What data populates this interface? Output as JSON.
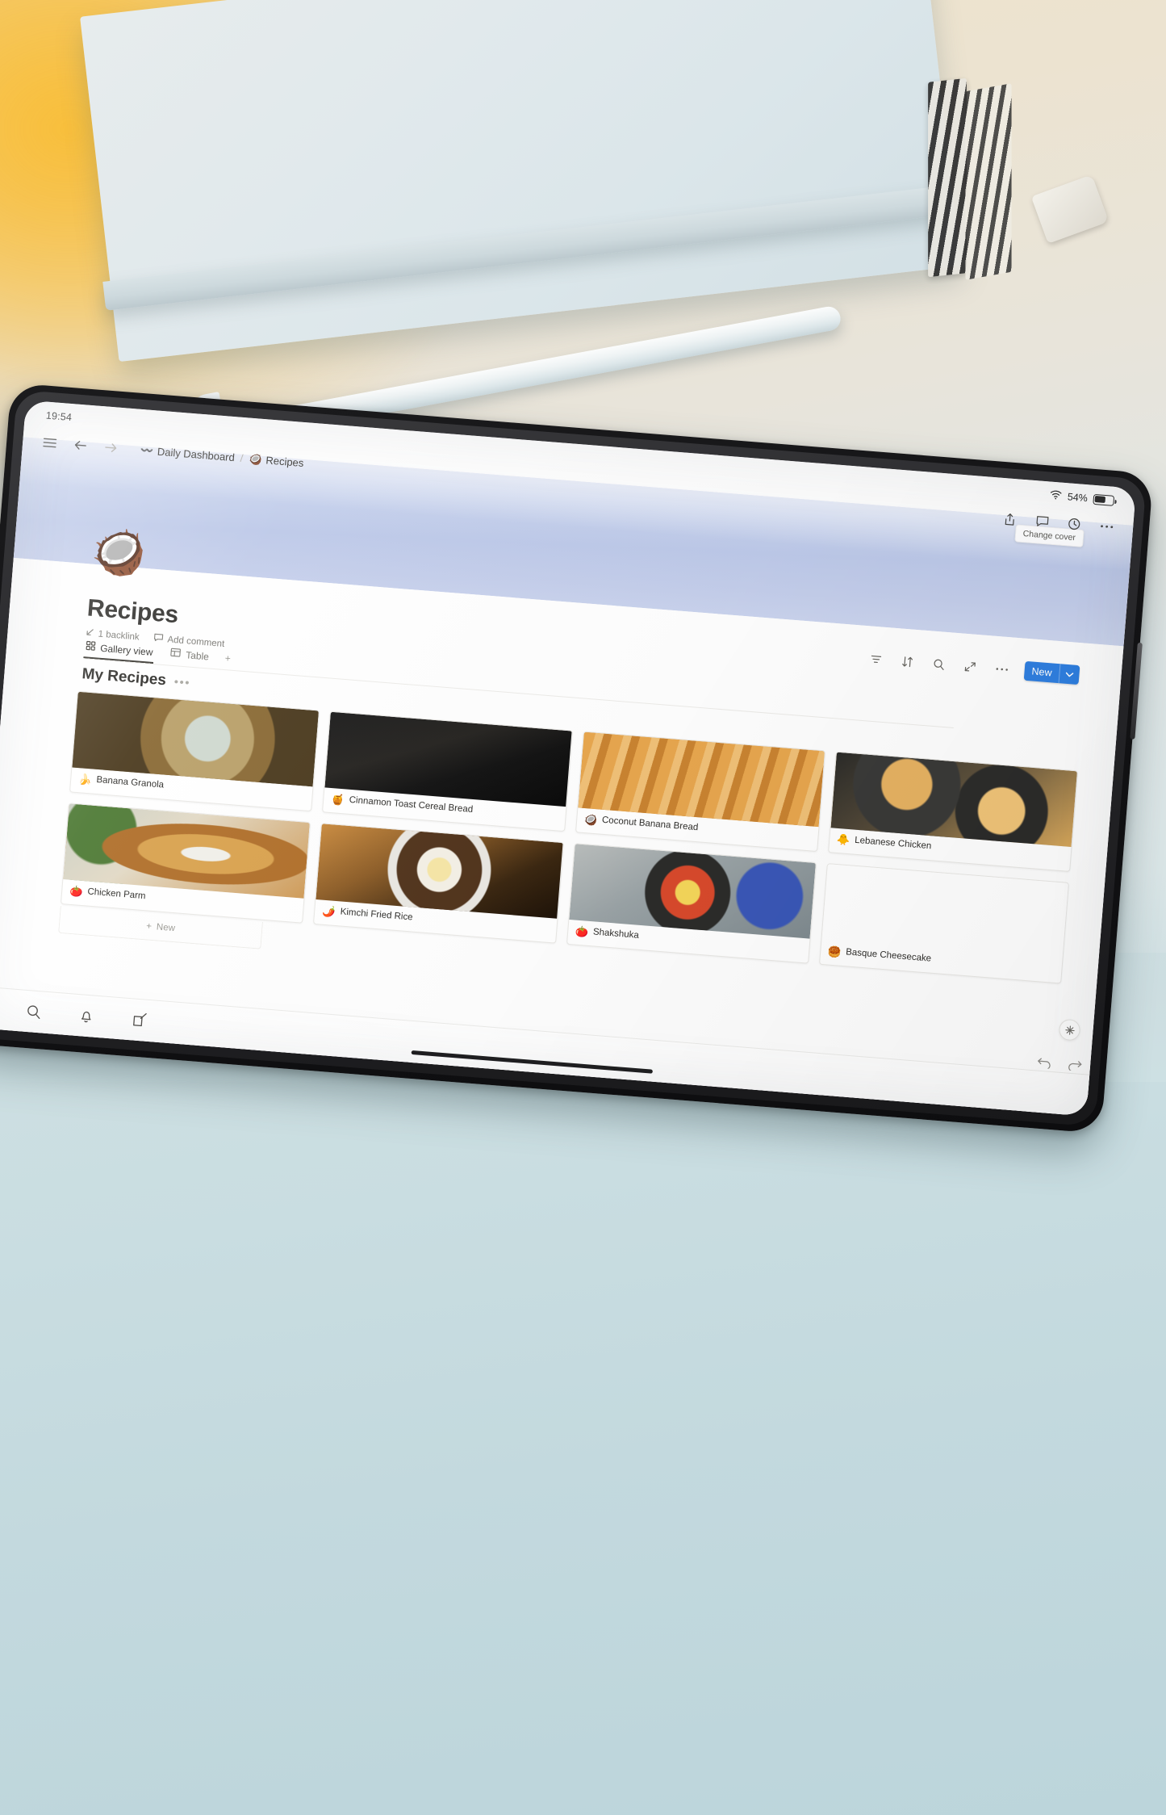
{
  "device": {
    "status_bar": {
      "time": "19:54",
      "wifi_icon": "wifi-icon",
      "battery_percent": "54%"
    },
    "bottom_bar": {
      "icons": [
        "search-icon",
        "bell-icon",
        "compose-icon"
      ]
    }
  },
  "browser": {
    "menu_icon": "hamburger-menu-icon",
    "back_icon": "back-arrow-icon",
    "forward_icon": "forward-arrow-icon",
    "share_icon": "share-icon",
    "comment_icon": "comment-icon",
    "history_icon": "clock-history-icon",
    "more_icon": "more-horizontal-icon",
    "breadcrumb": [
      {
        "emoji": "〰️",
        "label": "Daily Dashboard"
      },
      {
        "emoji": "🥥",
        "label": "Recipes"
      }
    ],
    "breadcrumb_separator": "/"
  },
  "cover": {
    "change_cover_label": "Change cover",
    "color_top": "#cfd7ee",
    "color_bottom": "#ccd5ee"
  },
  "page": {
    "icon_emoji": "🥥",
    "title": "Recipes",
    "backlink_label": "1 backlink",
    "backlink_icon": "backlink-arrow-icon",
    "add_comment_label": "Add comment",
    "comment_icon": "comment-bubble-icon"
  },
  "database": {
    "toolbar": {
      "filter_icon": "filter-icon",
      "sort_icon": "sort-icon",
      "search_icon": "search-icon",
      "expand_icon": "expand-icon",
      "more_icon": "more-horizontal-icon",
      "new_label": "New",
      "new_chevron_icon": "chevron-down-icon",
      "new_button_color": "#2f7fe0"
    },
    "views": [
      {
        "label": "Gallery view",
        "icon": "gallery-view-icon",
        "active": true
      },
      {
        "label": "Table",
        "icon": "table-view-icon",
        "active": false
      }
    ],
    "add_view_label": "+",
    "section_title": "My Recipes",
    "section_menu_icon": "more-horizontal-icon",
    "new_row_label": "New",
    "new_row_icon": "plus-icon",
    "cards": [
      {
        "emoji": "🍌",
        "title": "Banana Granola",
        "img": "img-granola"
      },
      {
        "emoji": "🍯",
        "title": "Cinnamon Toast Cereal Bread",
        "img": "img-cinnamon"
      },
      {
        "emoji": "🥥",
        "title": "Coconut Banana Bread",
        "img": "img-coconutbread"
      },
      {
        "emoji": "🐥",
        "title": "Lebanese Chicken",
        "img": "img-lebanese"
      },
      {
        "emoji": "🍅",
        "title": "Chicken Parm",
        "img": "img-chickenparm"
      },
      {
        "emoji": "🌶️",
        "title": "Kimchi Fried Rice",
        "img": "img-kimchi"
      },
      {
        "emoji": "🍅",
        "title": "Shakshuka",
        "img": "img-shakshuka"
      },
      {
        "emoji": "🥮",
        "title": "Basque Cheesecake",
        "img": "img-blank"
      }
    ]
  },
  "floating": {
    "ai_icon": "sparkle-ai-icon",
    "undo_icon": "undo-icon",
    "redo_icon": "redo-icon"
  }
}
